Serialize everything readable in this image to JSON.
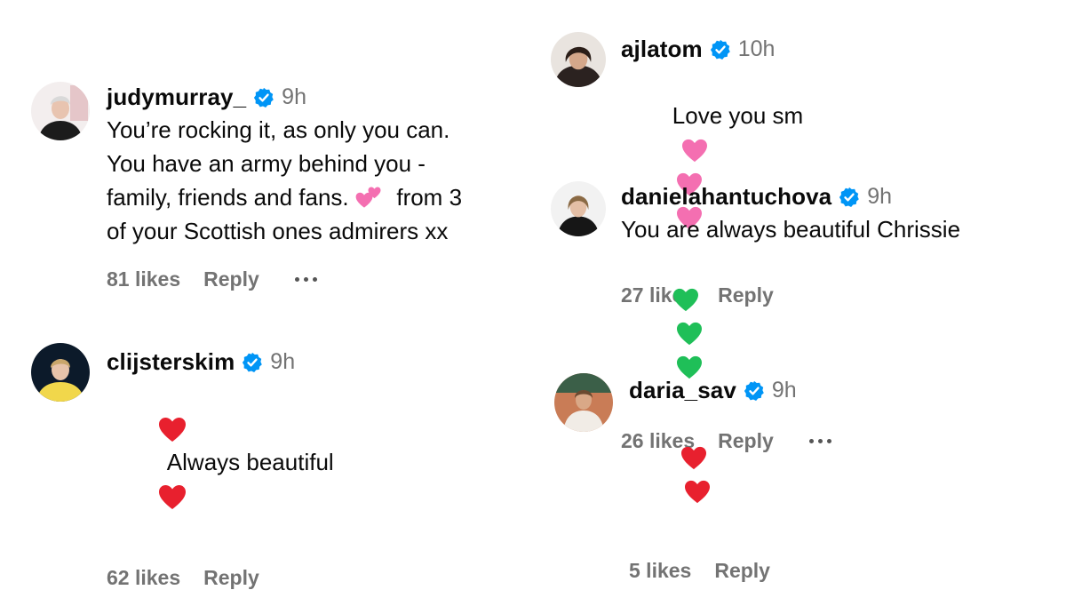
{
  "left": {
    "comments": [
      {
        "username": "judymurray_",
        "time": "9h",
        "lines": [
          "You’re rocking it, as only you can.",
          "You have an army behind you -",
          "family, friends and fans.",
          "from 3",
          "of your Scottish ones admirers xx"
        ],
        "likes": "81 likes",
        "reply": "Reply",
        "emoji": "two-hearts"
      },
      {
        "username": "clijsterskim",
        "time": "9h",
        "text": "Always beautiful",
        "likes": "62 likes",
        "reply": "Reply",
        "emoji": "red-heart"
      }
    ]
  },
  "right": {
    "comments": [
      {
        "username": "ajlatom",
        "time": "10h",
        "text": "Love you sm",
        "likes": "27 likes",
        "reply": "Reply",
        "emoji": "pink-heart"
      },
      {
        "username": "danielahantuchova",
        "time": "9h",
        "text": "You are always beautiful Chrissie",
        "likes": "26 likes",
        "reply": "Reply",
        "emoji": "green-heart"
      },
      {
        "username": "daria_sav",
        "time": "9h",
        "likes": "5 likes",
        "reply": "Reply",
        "emoji": "red-heart"
      }
    ]
  },
  "colors": {
    "verified_blue": "#0095f6",
    "secondary_text": "#737373",
    "red_heart": "#e8202e",
    "pink_heart": "#f46fb1",
    "green_heart": "#1fbf58"
  }
}
